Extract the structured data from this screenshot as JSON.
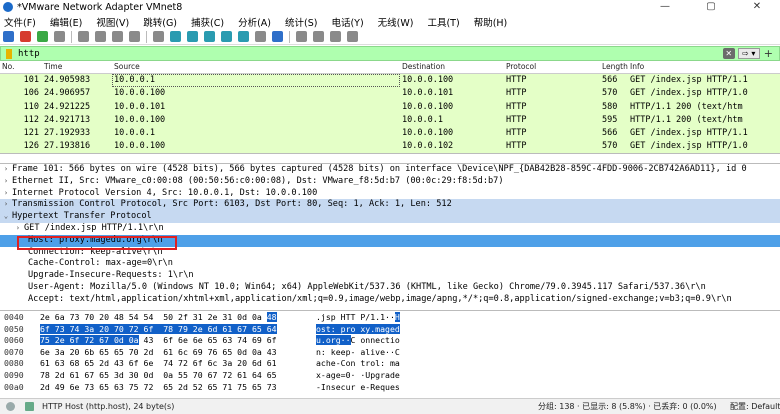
{
  "window": {
    "title": "*VMware Network Adapter VMnet8",
    "controls": [
      "—",
      "▢",
      "✕"
    ]
  },
  "menu": [
    "文件(F)",
    "编辑(E)",
    "视图(V)",
    "跳转(G)",
    "捕获(C)",
    "分析(A)",
    "统计(S)",
    "电话(Y)",
    "无线(W)",
    "工具(T)",
    "帮助(H)"
  ],
  "filter": {
    "value": "http",
    "apply_label": "⇨ ▾",
    "clear_label": "✕",
    "add_label": "+"
  },
  "packet_list": {
    "columns": [
      "No.",
      "Time",
      "Source",
      "Destination",
      "Protocol",
      "Length",
      "Info"
    ],
    "rows": [
      {
        "no": "101",
        "time": "24.905983",
        "src": "10.0.0.1",
        "dst": "10.0.0.100",
        "proto": "HTTP",
        "len": "566",
        "info": "GET /index.jsp HTTP/1.1"
      },
      {
        "no": "106",
        "time": "24.906957",
        "src": "10.0.0.100",
        "dst": "10.0.0.101",
        "proto": "HTTP",
        "len": "570",
        "info": "GET /index.jsp HTTP/1.0"
      },
      {
        "no": "110",
        "time": "24.921225",
        "src": "10.0.0.101",
        "dst": "10.0.0.100",
        "proto": "HTTP",
        "len": "580",
        "info": "HTTP/1.1 200  (text/htm"
      },
      {
        "no": "112",
        "time": "24.921713",
        "src": "10.0.0.100",
        "dst": "10.0.0.1",
        "proto": "HTTP",
        "len": "595",
        "info": "HTTP/1.1 200  (text/htm"
      },
      {
        "no": "121",
        "time": "27.192933",
        "src": "10.0.0.1",
        "dst": "10.0.0.100",
        "proto": "HTTP",
        "len": "566",
        "info": "GET /index.jsp HTTP/1.1"
      },
      {
        "no": "126",
        "time": "27.193816",
        "src": "10.0.0.100",
        "dst": "10.0.0.102",
        "proto": "HTTP",
        "len": "570",
        "info": "GET /index.jsp HTTP/1.0"
      }
    ]
  },
  "details": [
    {
      "arrow": "›",
      "text": "Frame 101: 566 bytes on wire (4528 bits), 566 bytes captured (4528 bits) on interface \\Device\\NPF_{DAB42B28-859C-4FDD-9006-2CB742A6AD11}, id 0"
    },
    {
      "arrow": "›",
      "text": "Ethernet II, Src: VMware_c0:00:08 (00:50:56:c0:00:08), Dst: VMware_f8:5d:b7 (00:0c:29:f8:5d:b7)"
    },
    {
      "arrow": "›",
      "text": "Internet Protocol Version 4, Src: 10.0.0.1, Dst: 10.0.0.100"
    },
    {
      "arrow": "›",
      "text": "Transmission Control Protocol, Src Port: 6103, Dst Port: 80, Seq: 1, Ack: 1, Len: 512"
    },
    {
      "arrow": "⌄",
      "text": "Hypertext Transfer Protocol"
    },
    {
      "arrow": "›",
      "text": "GET /index.jsp HTTP/1.1\\r\\n"
    },
    {
      "arrow": "",
      "text": "Host: proxy.magedu.org\\r\\n"
    },
    {
      "arrow": "",
      "text": "Connection: keep-alive\\r\\n"
    },
    {
      "arrow": "",
      "text": "Cache-Control: max-age=0\\r\\n"
    },
    {
      "arrow": "",
      "text": "Upgrade-Insecure-Requests: 1\\r\\n"
    },
    {
      "arrow": "",
      "text": "User-Agent: Mozilla/5.0 (Windows NT 10.0; Win64; x64) AppleWebKit/537.36 (KHTML, like Gecko) Chrome/79.0.3945.117 Safari/537.36\\r\\n"
    },
    {
      "arrow": "",
      "text": "Accept: text/html,application/xhtml+xml,application/xml;q=0.9,image/webp,image/apng,*/*;q=0.8,application/signed-exchange;v=b3;q=0.9\\r\\n"
    }
  ],
  "bytes": [
    {
      "off": "0040",
      "hex_a": "2e 6a 73 70 20 48 54 54  50 2f 31 2e 31 0d 0a ",
      "hex_sel": "48",
      "hex_b": "",
      "asc_a": ".jsp HTT P/1.1··",
      "asc_sel": "H",
      "asc_b": ""
    },
    {
      "off": "0050",
      "hex_a": "",
      "hex_sel": "6f 73 74 3a 20 70 72 6f  78 79 2e 6d 61 67 65 64",
      "hex_b": "",
      "asc_a": "",
      "asc_sel": "ost: pro xy.maged",
      "asc_b": ""
    },
    {
      "off": "0060",
      "hex_a": "",
      "hex_sel": "75 2e 6f 72 67 0d 0a",
      "hex_b": " 43  6f 6e 6e 65 63 74 69 6f",
      "asc_a": "",
      "asc_sel": "u.org··",
      "asc_b": "C onnectio"
    },
    {
      "off": "0070",
      "hex_a": "6e 3a 20 6b 65 65 70 2d  61 6c 69 76 65 0d 0a 43",
      "hex_sel": "",
      "hex_b": "",
      "asc_a": "n: keep- alive··C",
      "asc_sel": "",
      "asc_b": ""
    },
    {
      "off": "0080",
      "hex_a": "61 63 68 65 2d 43 6f 6e  74 72 6f 6c 3a 20 6d 61",
      "hex_sel": "",
      "hex_b": "",
      "asc_a": "ache-Con trol: ma",
      "asc_sel": "",
      "asc_b": ""
    },
    {
      "off": "0090",
      "hex_a": "78 2d 61 67 65 3d 30 0d  0a 55 70 67 72 61 64 65",
      "hex_sel": "",
      "hex_b": "",
      "asc_a": "x-age=0· ·Upgrade",
      "asc_sel": "",
      "asc_b": ""
    },
    {
      "off": "00a0",
      "hex_a": "2d 49 6e 73 65 63 75 72  65 2d 52 65 71 75 65 73",
      "hex_sel": "",
      "hex_b": "",
      "asc_a": "-Insecur e-Reques",
      "asc_sel": "",
      "asc_b": ""
    }
  ],
  "status": {
    "field": "HTTP Host (http.host), 24 byte(s)",
    "stats": "分组: 138 · 已显示: 8 (5.8%) · 已丢弃: 0 (0.0%)",
    "profile": "配置: Default"
  },
  "colors": {
    "filter_bg": "#afffaf",
    "row_bg": "#e4ffc7",
    "highlight": "#4ea0e8",
    "byte_sel": "#1160c8",
    "annotation": "#e02020"
  }
}
